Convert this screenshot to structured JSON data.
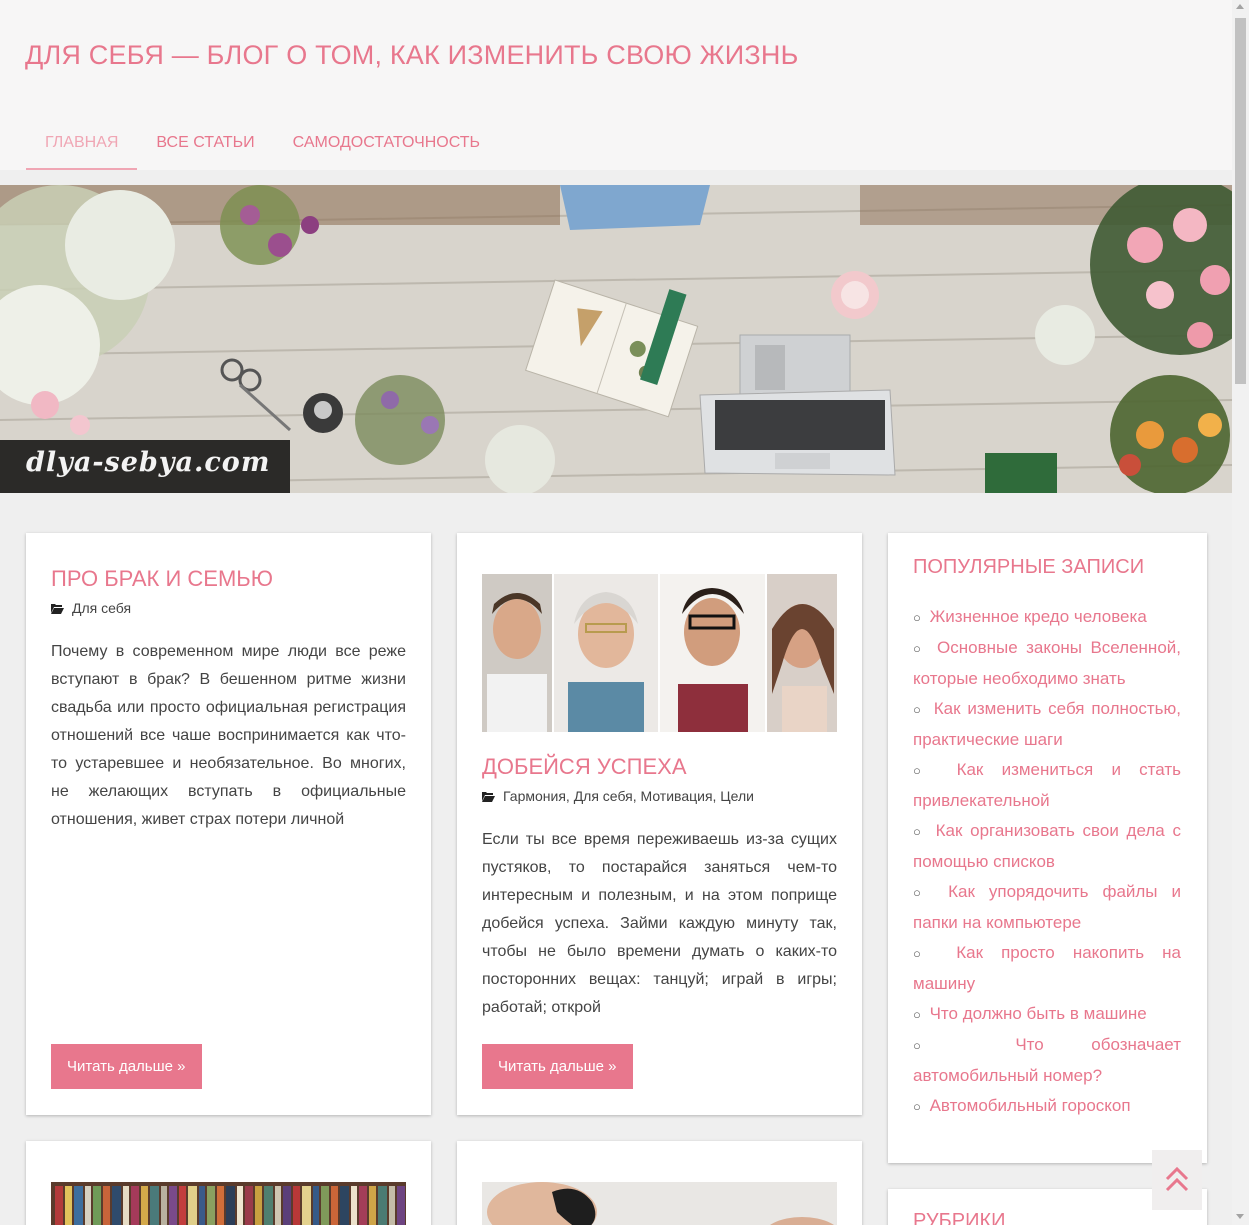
{
  "site": {
    "title": "Для себя — блог о том, как изменить свою жизнь",
    "accent_color": "#e8778d"
  },
  "nav": {
    "items": [
      {
        "label": "Главная",
        "active": true
      },
      {
        "label": "Все статьи",
        "active": false
      },
      {
        "label": "Самодостаточность",
        "active": false
      }
    ]
  },
  "banner": {
    "label": "dlya-sebya.com"
  },
  "posts": [
    {
      "title": "Про брак и семью",
      "categories": "Для себя",
      "excerpt": "Почему в современном мире люди все реже вступают в брак? В бешенном ритме жизни свадьба или просто официальная регистрация отношений все чаше воспринимается как что-то устаревшее и необязательное. Во многих, не желающих вступать в официальные отношения, живет страх потери личной",
      "read_more": "Читать дальше »"
    },
    {
      "title": "Добейся успеха",
      "categories": "Гармония, Для себя, Мотивация, Цели",
      "excerpt": "Если ты все время переживаешь из-за сущих пустяков, то постарайся заняться чем-то интересным и полезным, и на этом поприще добейся успеха. Займи каждую минуту так, чтобы не было времени думать о каких-то посторонних вещах: танцуй; играй в игры; работай; открой",
      "read_more": "Читать дальше »"
    }
  ],
  "sidebar": {
    "popular_title": "Популярные записи",
    "popular": [
      "Жизненное кредо человека",
      "Основные законы Вселенной, которые необходимо знать",
      "Как изменить себя полностью, практические шаги",
      "Как измениться и стать привлекательной",
      "Как организовать свои дела с помощью списков",
      "Как упорядочить файлы и папки на компьютере",
      "Как просто накопить на машину",
      "Что должно быть в машине",
      "Что обозначает автомобильный номер?",
      "Автомобильный гороскоп"
    ],
    "categories_title": "Рубрики"
  },
  "icons": {
    "meta": "folder-open-icon",
    "scroll_top": "double-chevron-up-icon"
  }
}
